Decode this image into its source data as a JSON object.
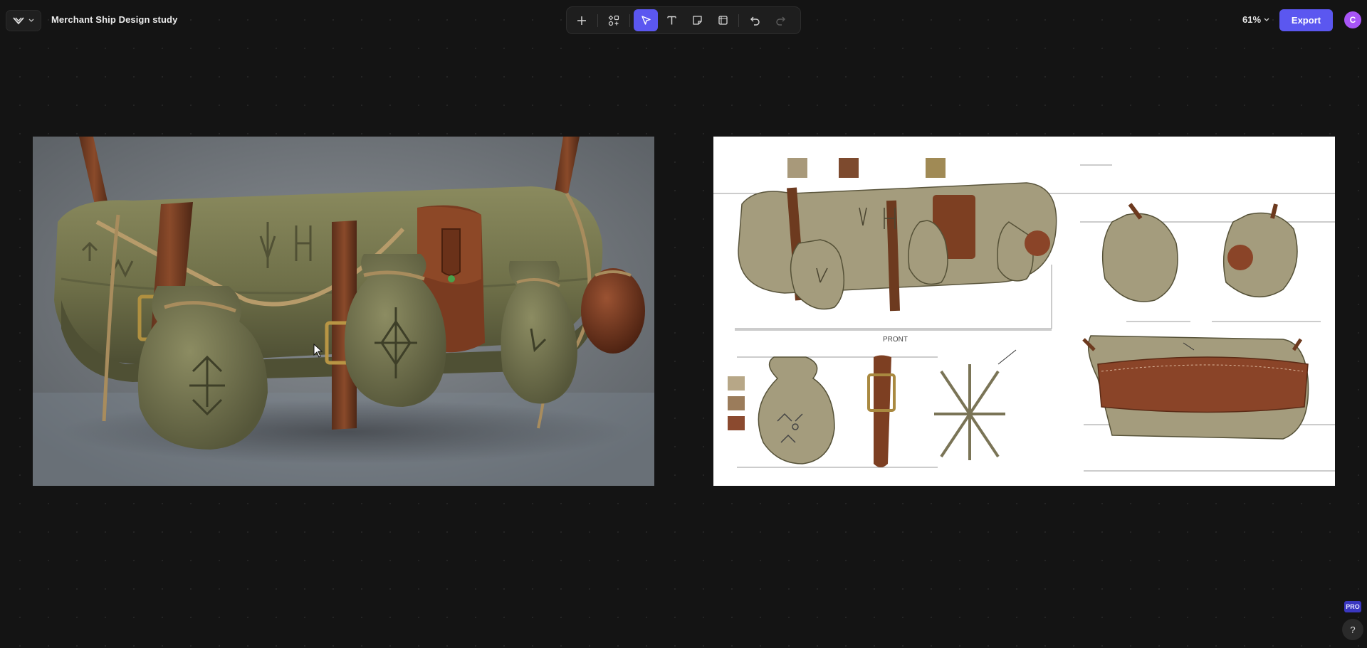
{
  "app": {
    "logo_icon": "chevron-logo-icon",
    "document_title": "Merchant Ship Design study"
  },
  "toolbar": {
    "tools": [
      {
        "name": "add",
        "icon": "plus-icon",
        "active": false
      },
      {
        "name": "components",
        "icon": "components-icon",
        "active": false
      },
      {
        "name": "select",
        "icon": "cursor-icon",
        "active": true
      },
      {
        "name": "text",
        "icon": "text-icon",
        "active": false
      },
      {
        "name": "sticky",
        "icon": "note-icon",
        "active": false
      },
      {
        "name": "frame",
        "icon": "frame-icon",
        "active": false
      },
      {
        "name": "undo",
        "icon": "undo-icon",
        "active": false
      },
      {
        "name": "redo",
        "icon": "redo-icon",
        "active": false,
        "disabled": true
      }
    ]
  },
  "zoom": {
    "label": "61%"
  },
  "export": {
    "label": "Export"
  },
  "user": {
    "avatar_initial": "C"
  },
  "canvas": {
    "frames": [
      {
        "name": "render-image",
        "description_icon": "image"
      },
      {
        "name": "concept-sheet",
        "caption": "PRONT"
      }
    ]
  },
  "footer": {
    "pro_label": "PRO",
    "help_label": "?"
  },
  "colors": {
    "accent": "#5b57f0",
    "avatar": "#a855f7",
    "background": "#141414"
  }
}
